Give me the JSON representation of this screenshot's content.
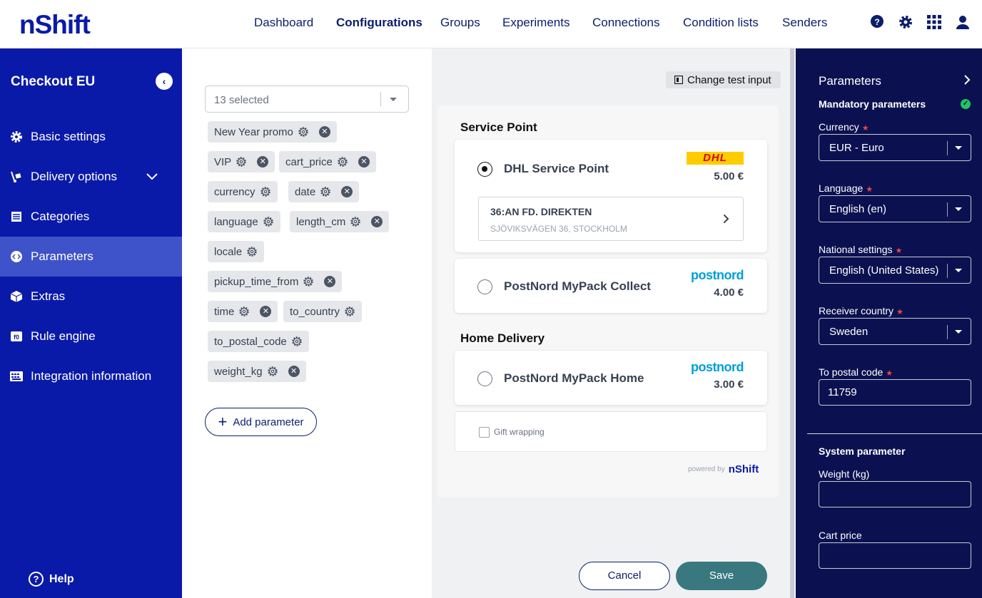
{
  "header": {
    "logo": "nShift",
    "nav": [
      "Dashboard",
      "Configurations",
      "Groups",
      "Experiments",
      "Connections",
      "Condition lists",
      "Senders"
    ],
    "active_nav": "Configurations"
  },
  "sidebar": {
    "title": "Checkout EU",
    "items": [
      {
        "label": "Basic settings",
        "icon": "gear-icon"
      },
      {
        "label": "Delivery options",
        "icon": "hand-truck-icon"
      },
      {
        "label": "Categories",
        "icon": "list-icon"
      },
      {
        "label": "Parameters",
        "icon": "code-icon"
      },
      {
        "label": "Extras",
        "icon": "box-icon"
      },
      {
        "label": "Rule engine",
        "icon": "rule-icon"
      },
      {
        "label": "Integration information",
        "icon": "keyboard-icon"
      }
    ],
    "active": "Parameters",
    "help": "Help"
  },
  "parameters": {
    "select_value": "13 selected",
    "chips": [
      "New Year promo",
      "VIP",
      "cart_price",
      "currency",
      "date",
      "language",
      "length_cm",
      "locale",
      "pickup_time_from",
      "time",
      "to_country",
      "to_postal_code",
      "weight_kg"
    ],
    "add_button": "Add parameter"
  },
  "preview": {
    "change_input": "Change test input",
    "sections": {
      "service_point": "Service Point",
      "home_delivery": "Home Delivery"
    },
    "options": [
      {
        "name": "DHL Service Point",
        "price": "5.00 €",
        "carrier": "DHL",
        "selected": true
      },
      {
        "name": "PostNord MyPack Collect",
        "price": "4.00 €",
        "carrier": "postnord",
        "selected": false
      },
      {
        "name": "PostNord MyPack Home",
        "price": "3.00 €",
        "carrier": "postnord",
        "selected": false
      }
    ],
    "service_point": {
      "name": "36:AN FD. DIREKTEN",
      "address": "SJÖVIKSVÄGEN 36, STOCKHOLM"
    },
    "gift_wrapping": "Gift wrapping",
    "powered_by": "powered by",
    "powered_brand": "nShift",
    "cancel": "Cancel",
    "save": "Save"
  },
  "right_panel": {
    "title": "Parameters",
    "mandatory_title": "Mandatory parameters",
    "fields": [
      {
        "label": "Currency",
        "value": "EUR - Euro"
      },
      {
        "label": "Language",
        "value": "English (en)"
      },
      {
        "label": "National settings",
        "value": "English (United States)"
      },
      {
        "label": "Receiver country",
        "value": "Sweden"
      }
    ],
    "postal_label": "To postal code",
    "postal_value": "11759",
    "system_title": "System parameter",
    "weight_label": "Weight (kg)",
    "weight_value": "",
    "cart_label": "Cart price",
    "cart_value": ""
  },
  "colors": {
    "sidebar_bg": "#0a1aa8",
    "sidebar_active": "#3e52c9",
    "right_panel_bg": "#0b1150",
    "save_bg": "#3a7880",
    "dhl_yellow": "#ffcc00",
    "dhl_red": "#d40511",
    "postnord_blue": "#00a0d6"
  }
}
